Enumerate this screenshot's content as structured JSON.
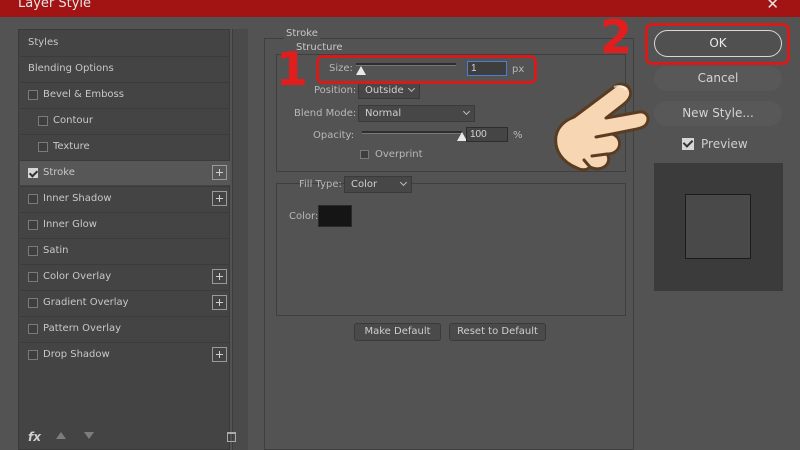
{
  "window": {
    "title": "Layer Style",
    "close_symbol": "✕"
  },
  "styles_list": {
    "items": [
      {
        "label": "Styles",
        "checkbox": false,
        "checked": false,
        "plus": false,
        "indent": 0
      },
      {
        "label": "Blending Options",
        "checkbox": false,
        "checked": false,
        "plus": false,
        "indent": 0
      },
      {
        "label": "Bevel & Emboss",
        "checkbox": true,
        "checked": false,
        "plus": false,
        "indent": 0
      },
      {
        "label": "Contour",
        "checkbox": true,
        "checked": false,
        "plus": false,
        "indent": 1
      },
      {
        "label": "Texture",
        "checkbox": true,
        "checked": false,
        "plus": false,
        "indent": 1
      },
      {
        "label": "Stroke",
        "checkbox": true,
        "checked": true,
        "plus": true,
        "indent": 0,
        "selected": true
      },
      {
        "label": "Inner Shadow",
        "checkbox": true,
        "checked": false,
        "plus": true,
        "indent": 0
      },
      {
        "label": "Inner Glow",
        "checkbox": true,
        "checked": false,
        "plus": false,
        "indent": 0
      },
      {
        "label": "Satin",
        "checkbox": true,
        "checked": false,
        "plus": false,
        "indent": 0
      },
      {
        "label": "Color Overlay",
        "checkbox": true,
        "checked": false,
        "plus": true,
        "indent": 0
      },
      {
        "label": "Gradient Overlay",
        "checkbox": true,
        "checked": false,
        "plus": true,
        "indent": 0
      },
      {
        "label": "Pattern Overlay",
        "checkbox": true,
        "checked": false,
        "plus": false,
        "indent": 0
      },
      {
        "label": "Drop Shadow",
        "checkbox": true,
        "checked": false,
        "plus": true,
        "indent": 0
      }
    ],
    "footer": {
      "fx_label": "fx"
    }
  },
  "stroke": {
    "section_title": "Stroke",
    "structure_title": "Structure",
    "size_label": "Size:",
    "size_value": "1",
    "size_unit": "px",
    "position_label": "Position:",
    "position_value": "Outside",
    "blend_mode_label": "Blend Mode:",
    "blend_mode_value": "Normal",
    "opacity_label": "Opacity:",
    "opacity_value": "100",
    "opacity_unit": "%",
    "overprint_label": "Overprint",
    "fill_type_label": "Fill Type:",
    "fill_type_value": "Color",
    "color_label": "Color:",
    "color_value": "#151515",
    "make_default_label": "Make Default",
    "reset_default_label": "Reset to Default"
  },
  "actions": {
    "ok_label": "OK",
    "cancel_label": "Cancel",
    "new_style_label": "New Style...",
    "preview_label": "Preview"
  },
  "annotations": {
    "step1": "1",
    "step2": "2"
  },
  "colors": {
    "title_bar": "#a11413",
    "highlight": "#d71a1a",
    "panel": "#535353"
  }
}
